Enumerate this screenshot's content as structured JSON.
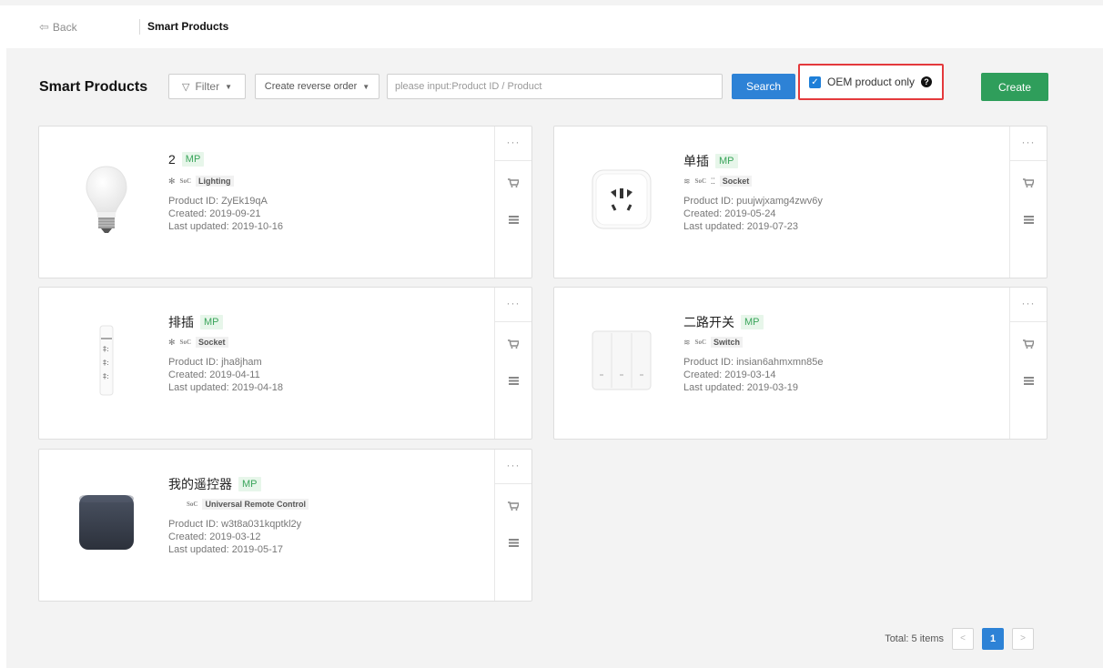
{
  "topbar": {
    "back_label": "Back",
    "breadcrumb_title": "Smart Products"
  },
  "toolbar": {
    "page_title": "Smart Products",
    "filter_label": "Filter",
    "reverse_label": "Create reverse order",
    "search_placeholder": "please input:Product ID / Product",
    "search_label": "Search",
    "oem_label": "OEM product only",
    "create_label": "Create"
  },
  "products": [
    {
      "name": "2",
      "badge": "MP",
      "soc": "SoC",
      "category": "Lighting",
      "product_id": "Product ID: ZyEk19qA",
      "created": "Created: 2019-09-21",
      "updated": "Last updated: 2019-10-16"
    },
    {
      "name": "单插",
      "badge": "MP",
      "soc": "SoC",
      "category": "Socket",
      "product_id": "Product ID: puujwjxamg4zwv6y",
      "created": "Created: 2019-05-24",
      "updated": "Last updated: 2019-07-23"
    },
    {
      "name": "排插",
      "badge": "MP",
      "soc": "SoC",
      "category": "Socket",
      "product_id": "Product ID: jha8jham",
      "created": "Created: 2019-04-11",
      "updated": "Last updated: 2019-04-18"
    },
    {
      "name": "二路开关",
      "badge": "MP",
      "soc": "SoC",
      "category": "Switch",
      "product_id": "Product ID: insian6ahmxmn85e",
      "created": "Created: 2019-03-14",
      "updated": "Last updated: 2019-03-19"
    },
    {
      "name": "我的遥控器",
      "badge": "MP",
      "soc": "SoC",
      "category": "Universal Remote Control",
      "product_id": "Product ID: w3t8a031kqptkl2y",
      "created": "Created: 2019-03-12",
      "updated": "Last updated: 2019-05-17"
    }
  ],
  "pagination": {
    "total_label": "Total: 5 items",
    "current_page": "1",
    "prev": "<",
    "next": ">"
  },
  "colors": {
    "primary": "#2d82d6",
    "create": "#2f9e5b",
    "highlight": "#e4393c",
    "badge_text": "#3aa55b"
  }
}
